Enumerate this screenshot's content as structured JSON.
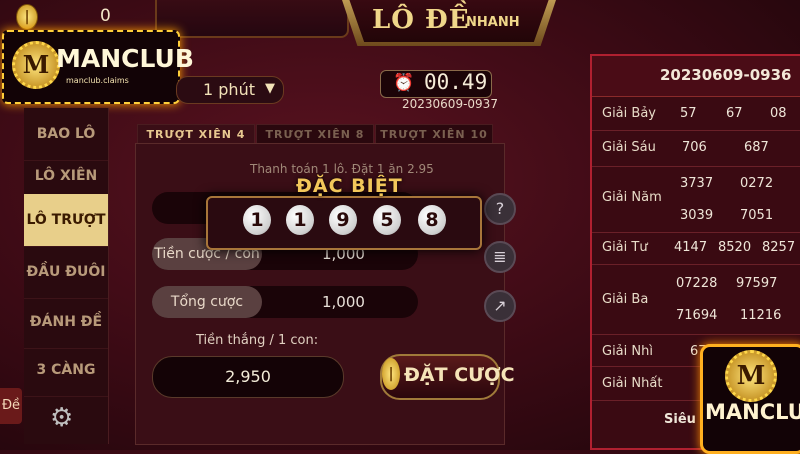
{
  "header": {
    "coin_icon": "gold-coin-icon",
    "coin_balance": "0",
    "title_main": "LÔ ĐỀ",
    "title_sub": "NHANH"
  },
  "brand": {
    "logo_letter": "M",
    "logo_text": "MANCLUB",
    "logo_site": "manclub.claims"
  },
  "time_select": {
    "label": "1 phút",
    "caret": "▼"
  },
  "timer": {
    "icon": "alarm-clock-icon",
    "countdown": "00.49",
    "round_id": "20230609-0937"
  },
  "sidebar": {
    "items": [
      {
        "label": "BAO LÔ"
      },
      {
        "label": "LÔ XIÊN"
      },
      {
        "label": "LÔ TRƯỢT",
        "active": true
      },
      {
        "label": "ĐẦU ĐUÔI"
      },
      {
        "label": "ĐÁNH ĐỀ"
      },
      {
        "label": "3 CÀNG"
      }
    ],
    "settings_icon": "gear-icon",
    "side_tab_label": "Đề"
  },
  "tabs": [
    {
      "label": "TRƯỢT XIÊN 4",
      "active": true
    },
    {
      "label": "TRƯỢT XIÊN 8"
    },
    {
      "label": "TRƯỢT XIÊN 10"
    }
  ],
  "bet_form": {
    "payout_text": "Thanh toán 1 lô. Đặt 1 ăn 2.95",
    "stake_label": "Tiền cược / con",
    "stake_value": "1,000",
    "total_label": "Tổng cược",
    "total_value": "1,000",
    "win_label": "Tiền thắng / 1 con:",
    "win_value": "2,950",
    "bet_button": "ĐẶT CƯỢC"
  },
  "special_popup": {
    "title": "ĐẶC BIỆT",
    "digits": [
      "1",
      "1",
      "9",
      "5",
      "8"
    ]
  },
  "side_icons": [
    "help-icon",
    "bet-history-icon",
    "chart-icon"
  ],
  "results": {
    "round_id": "20230609-0936",
    "rows": [
      {
        "label": "Giải Bảy",
        "values": [
          "57",
          "67",
          "08"
        ]
      },
      {
        "label": "Giải Sáu",
        "values": [
          "706",
          "687"
        ]
      },
      {
        "label": "Giải Năm",
        "values": [
          "3737",
          "0272",
          "3039",
          "7051"
        ]
      },
      {
        "label": "Giải Tư",
        "values": [
          "4147",
          "8520",
          "8257"
        ]
      },
      {
        "label": "Giải Ba",
        "values": [
          "07228",
          "97597",
          "71694",
          "11216"
        ]
      },
      {
        "label": "Giải Nhì",
        "values": [
          "67"
        ]
      },
      {
        "label": "Giải Nhất",
        "values": []
      }
    ],
    "footer_text": "Siêu"
  }
}
